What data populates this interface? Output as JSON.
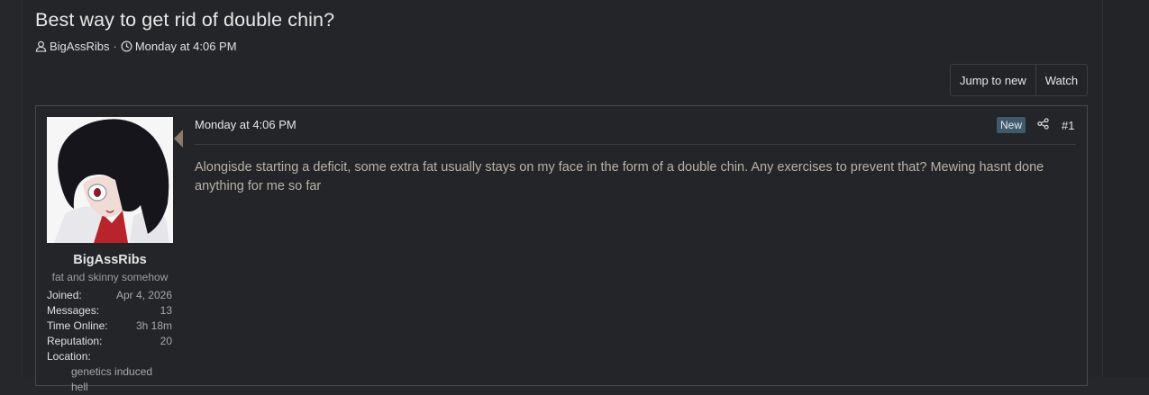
{
  "thread": {
    "title": "Best way to get rid of double chin?",
    "author": "BigAssRibs",
    "separator": "·",
    "date": "Monday at 4:06 PM"
  },
  "actions": {
    "jump_to_new": "Jump to new",
    "watch": "Watch"
  },
  "post": {
    "date": "Monday at 4:06 PM",
    "badge": "New",
    "number": "#1",
    "body": "Alongisde starting a deficit, some extra fat usually stays on my face in the form of a double chin. Any exercises to prevent that? Mewing hasnt done anything for me so far",
    "icons": {
      "author": "user-icon",
      "time": "clock-icon",
      "share": "share-icon"
    }
  },
  "user": {
    "name": "BigAssRibs",
    "title": "fat and skinny somehow",
    "stats": [
      {
        "label": "Joined:",
        "value": "Apr 4, 2026"
      },
      {
        "label": "Messages:",
        "value": "13"
      },
      {
        "label": "Time Online:",
        "value": "3h 18m"
      },
      {
        "label": "Reputation:",
        "value": "20"
      }
    ],
    "location_label": "Location:",
    "location_value": "genetics induced hell"
  },
  "colors": {
    "background": "#26272a",
    "post_border": "#48494d",
    "badge": "#3e5a6c",
    "body_text": "#b9b2a8"
  }
}
